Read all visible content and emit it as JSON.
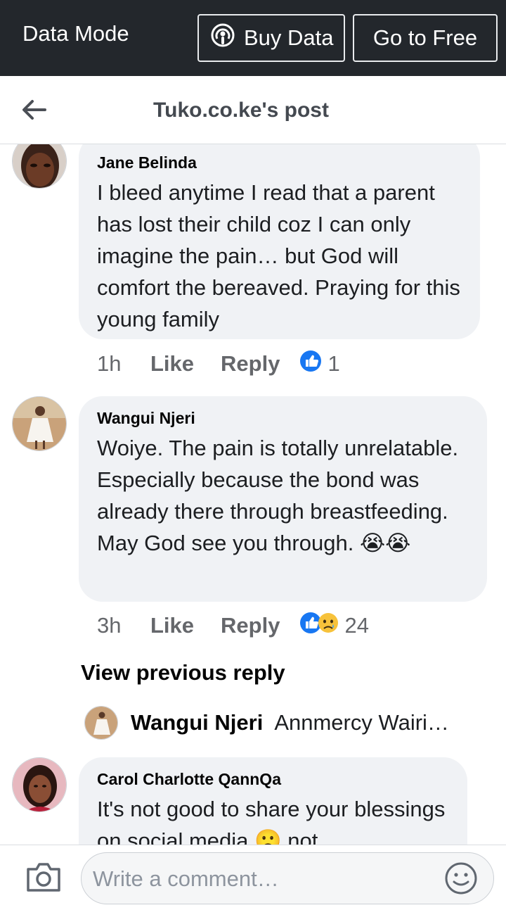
{
  "topbar": {
    "data_mode_label": "Data Mode",
    "buy_data_label": "Buy Data",
    "go_free_label": "Go to Free",
    "background": "#23272c"
  },
  "header": {
    "title": "Tuko.co.ke's post"
  },
  "comments": [
    {
      "author": "Jane Belinda",
      "text": "I bleed anytime I read that a parent has lost their child coz I can only imagine the pain… but God will comfort the bereaved. Praying for this young family",
      "time": "1h",
      "like_label": "Like",
      "reply_label": "Reply",
      "reaction_count": "1",
      "reactions": [
        "like-icon"
      ]
    },
    {
      "author": "Wangui Njeri",
      "text": "Woiye. The pain is totally unrelatable. Especially because the bond was already there through breastfeeding. May God see you through. 😭😭",
      "time": "3h",
      "like_label": "Like",
      "reply_label": "Reply",
      "reaction_count": "24",
      "reactions": [
        "like-icon",
        "sad-icon"
      ]
    },
    {
      "author": "Carol Charlotte QannQa",
      "text": "It's not good to share your blessings on social media 🙁 not"
    }
  ],
  "view_previous_reply": "View previous reply",
  "reply_preview": {
    "author": "Wangui Njeri",
    "text": "Annmercy Wairi…"
  },
  "composer": {
    "placeholder": "Write a comment…"
  },
  "colors": {
    "like_blue": "#1877f2",
    "bubble": "#f0f2f5",
    "meta_gray": "#65676b"
  }
}
